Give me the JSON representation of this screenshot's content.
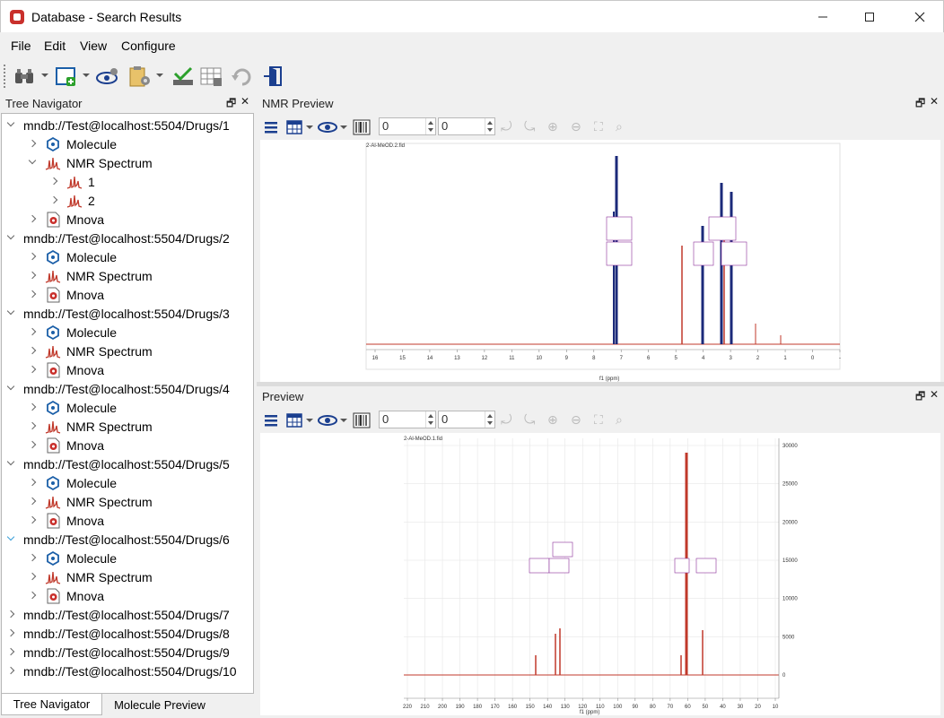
{
  "window": {
    "title": "Database - Search Results"
  },
  "menu": [
    "File",
    "Edit",
    "View",
    "Configure"
  ],
  "left_panel": {
    "title": "Tree Navigator",
    "tabs": [
      "Tree Navigator",
      "Molecule Preview"
    ],
    "tree": [
      {
        "label": "mndb://Test@localhost:5504/Drugs/1",
        "level": 0,
        "state": "open",
        "icon": ""
      },
      {
        "label": "Molecule",
        "level": 1,
        "state": "closed",
        "icon": "molecule-icon"
      },
      {
        "label": "NMR Spectrum",
        "level": 1,
        "state": "open",
        "icon": "nmr-spectrum-icon"
      },
      {
        "label": "1",
        "level": 2,
        "state": "closed",
        "icon": "nmr-spectrum-icon"
      },
      {
        "label": "2",
        "level": 2,
        "state": "closed",
        "icon": "nmr-spectrum-icon"
      },
      {
        "label": "Mnova",
        "level": 1,
        "state": "closed",
        "icon": "mnova-document-icon"
      },
      {
        "label": "mndb://Test@localhost:5504/Drugs/2",
        "level": 0,
        "state": "open",
        "icon": ""
      },
      {
        "label": "Molecule",
        "level": 1,
        "state": "closed",
        "icon": "molecule-icon"
      },
      {
        "label": "NMR Spectrum",
        "level": 1,
        "state": "closed",
        "icon": "nmr-spectrum-icon"
      },
      {
        "label": "Mnova",
        "level": 1,
        "state": "closed",
        "icon": "mnova-document-icon"
      },
      {
        "label": "mndb://Test@localhost:5504/Drugs/3",
        "level": 0,
        "state": "open",
        "icon": ""
      },
      {
        "label": "Molecule",
        "level": 1,
        "state": "closed",
        "icon": "molecule-icon"
      },
      {
        "label": "NMR Spectrum",
        "level": 1,
        "state": "closed",
        "icon": "nmr-spectrum-icon"
      },
      {
        "label": "Mnova",
        "level": 1,
        "state": "closed",
        "icon": "mnova-document-icon"
      },
      {
        "label": "mndb://Test@localhost:5504/Drugs/4",
        "level": 0,
        "state": "open",
        "icon": ""
      },
      {
        "label": "Molecule",
        "level": 1,
        "state": "closed",
        "icon": "molecule-icon"
      },
      {
        "label": "NMR Spectrum",
        "level": 1,
        "state": "closed",
        "icon": "nmr-spectrum-icon"
      },
      {
        "label": "Mnova",
        "level": 1,
        "state": "closed",
        "icon": "mnova-document-icon"
      },
      {
        "label": "mndb://Test@localhost:5504/Drugs/5",
        "level": 0,
        "state": "open",
        "icon": ""
      },
      {
        "label": "Molecule",
        "level": 1,
        "state": "closed",
        "icon": "molecule-icon"
      },
      {
        "label": "NMR Spectrum",
        "level": 1,
        "state": "closed",
        "icon": "nmr-spectrum-icon"
      },
      {
        "label": "Mnova",
        "level": 1,
        "state": "closed",
        "icon": "mnova-document-icon"
      },
      {
        "label": "mndb://Test@localhost:5504/Drugs/6",
        "level": 0,
        "state": "open-selected",
        "icon": ""
      },
      {
        "label": "Molecule",
        "level": 1,
        "state": "closed",
        "icon": "molecule-icon"
      },
      {
        "label": "NMR Spectrum",
        "level": 1,
        "state": "closed",
        "icon": "nmr-spectrum-icon"
      },
      {
        "label": "Mnova",
        "level": 1,
        "state": "closed",
        "icon": "mnova-document-icon"
      },
      {
        "label": "mndb://Test@localhost:5504/Drugs/7",
        "level": 0,
        "state": "closed",
        "icon": ""
      },
      {
        "label": "mndb://Test@localhost:5504/Drugs/8",
        "level": 0,
        "state": "closed",
        "icon": ""
      },
      {
        "label": "mndb://Test@localhost:5504/Drugs/9",
        "level": 0,
        "state": "closed",
        "icon": ""
      },
      {
        "label": "mndb://Test@localhost:5504/Drugs/10",
        "level": 0,
        "state": "closed",
        "icon": ""
      }
    ]
  },
  "nmr_preview": {
    "title": "NMR Preview",
    "spin1": "0",
    "spin2": "0",
    "filename": "2-Al-MeOD.2.fid",
    "axis_label": "f1 (ppm)",
    "ticks": [
      "16",
      "15",
      "14",
      "13",
      "12",
      "11",
      "10",
      "9",
      "8",
      "7",
      "6",
      "5",
      "4",
      "3",
      "2",
      "1",
      "0",
      "-"
    ]
  },
  "preview": {
    "title": "Preview",
    "spin1": "0",
    "spin2": "0",
    "filename": "2-Al-MeOD.1.fid",
    "axis_label": "f1 (ppm)",
    "ticks": [
      "220",
      "210",
      "200",
      "190",
      "180",
      "170",
      "160",
      "150",
      "140",
      "130",
      "120",
      "110",
      "100",
      "90",
      "80",
      "70",
      "60",
      "50",
      "40",
      "30",
      "20",
      "10"
    ],
    "y_ticks": [
      "30000",
      "25000",
      "20000",
      "15000",
      "10000",
      "5000",
      "0"
    ]
  },
  "colors": {
    "accent": "#1b3f8f",
    "spectrum": "#c0392b",
    "annotation": "#8b2f9a",
    "peak_label": "#27c24c"
  }
}
